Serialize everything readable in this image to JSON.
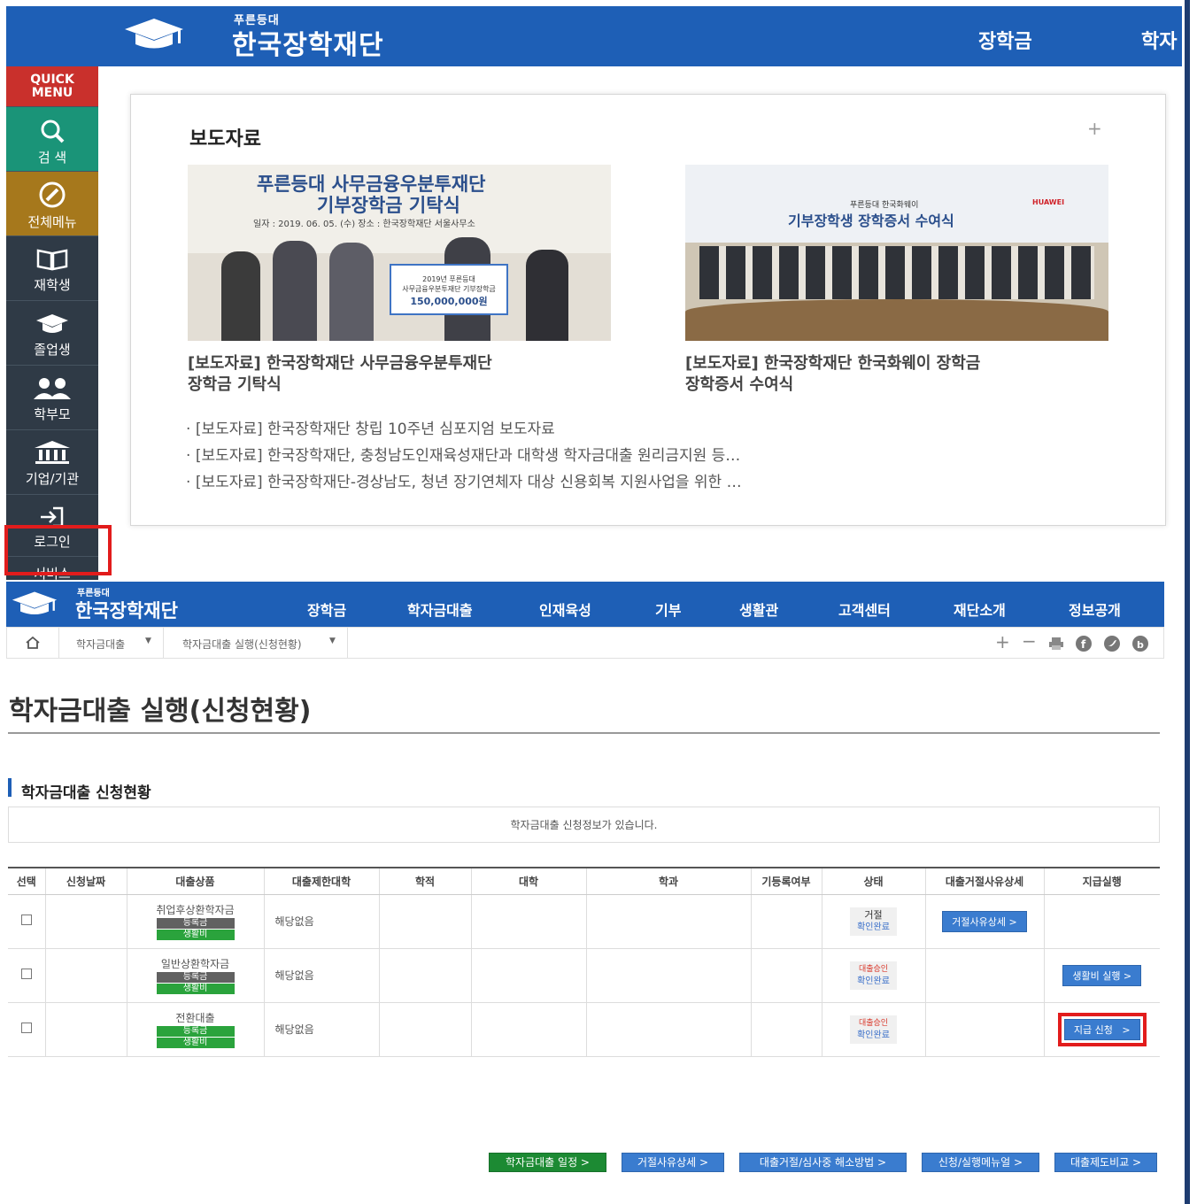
{
  "top": {
    "logo_small": "푸른등대",
    "logo_big": "한국장학재단",
    "nav": [
      "장학금",
      "학자"
    ],
    "quick_menu": {
      "title_line1": "QUICK",
      "title_line2": "MENU",
      "items": [
        {
          "label": "검 색",
          "icon": "search-icon"
        },
        {
          "label": "전체메뉴",
          "icon": "compass-icon"
        },
        {
          "label": "재학생",
          "icon": "book-icon"
        },
        {
          "label": "졸업생",
          "icon": "graduation-cap-icon"
        },
        {
          "label": "학부모",
          "icon": "people-icon"
        },
        {
          "label": "기업/기관",
          "icon": "building-icon"
        },
        {
          "label": "로그인",
          "icon": "login-icon"
        },
        {
          "label": "서비스",
          "icon": ""
        }
      ]
    },
    "news": {
      "title": "보도자료",
      "plus": "+",
      "featured": [
        {
          "image_title_line1": "푸른등대 사무금융우분투재단",
          "image_title_line2": "기부장학금 기탁식",
          "image_subtitle": "일자 : 2019. 06. 05. (수)    장소 : 한국장학재단 서울사무소",
          "image_board_line1": "2019년 푸른등대",
          "image_board_line2": "사무금융우분투재단 기부장학금",
          "image_board_amount": "150,000,000원",
          "caption_line1": "[보도자료] 한국장학재단 사무금융우분투재단",
          "caption_line2": "장학금 기탁식"
        },
        {
          "image_title_small": "푸른등대 한국화웨이",
          "image_title_line1": "기부장학생 장학증서 수여식",
          "image_brand": "HUAWEI",
          "caption_line1": "[보도자료] 한국장학재단 한국화웨이 장학금",
          "caption_line2": "장학증서 수여식"
        }
      ],
      "list": [
        "[보도자료] 한국장학재단 창립 10주년 심포지엄 보도자료",
        "[보도자료] 한국장학재단, 충청남도인재육성재단과 대학생 학자금대출 원리금지원 등…",
        "[보도자료] 한국장학재단-경상남도, 청년 장기연체자 대상 신용회복 지원사업을 위한 …"
      ]
    }
  },
  "bottom": {
    "logo_small": "푸른등대",
    "logo_big": "한국장학재단",
    "nav": [
      "장학금",
      "학자금대출",
      "인재육성",
      "기부",
      "생활관",
      "고객센터",
      "재단소개",
      "정보공개"
    ],
    "breadcrumb": [
      "학자금대출",
      "학자금대출 실행(신청현황)"
    ],
    "page_title": "학자금대출 실행(신청현황)",
    "section_title": "학자금대출 신청현황",
    "notice": "학자금대출 신청정보가 있습니다.",
    "table": {
      "headers": [
        "선택",
        "신청날짜",
        "대출상품",
        "대출제한대학",
        "학적",
        "대학",
        "학과",
        "기등록여부",
        "상태",
        "대출거절사유상세",
        "지급실행"
      ],
      "rows": [
        {
          "product": "취업후상환학자금",
          "tag1": "등록금",
          "tag2": "생활비",
          "limit": "해당없음",
          "status_top": "거절",
          "status_bottom": "확인완료",
          "reject_btn": "거절사유상세 >",
          "pay_btn": ""
        },
        {
          "product": "일반상환학자금",
          "tag1": "등록금",
          "tag2": "생활비",
          "limit": "해당없음",
          "status_top": "대출승인",
          "status_bottom": "확인완료",
          "reject_btn": "",
          "pay_btn": "생활비 실행 >"
        },
        {
          "product": "전환대출",
          "tag1": "등록금",
          "tag2": "생활비",
          "limit": "해당없음",
          "status_top": "대출승인",
          "status_bottom": "확인완료",
          "reject_btn": "",
          "pay_btn": "지급 신청   >"
        }
      ]
    },
    "buttons": [
      "학자금대출 일정 >",
      "거절사유상세 >",
      "대출거절/심사중 해소방법 >",
      "신청/실행메뉴얼 >",
      "대출제도비교 >"
    ]
  }
}
